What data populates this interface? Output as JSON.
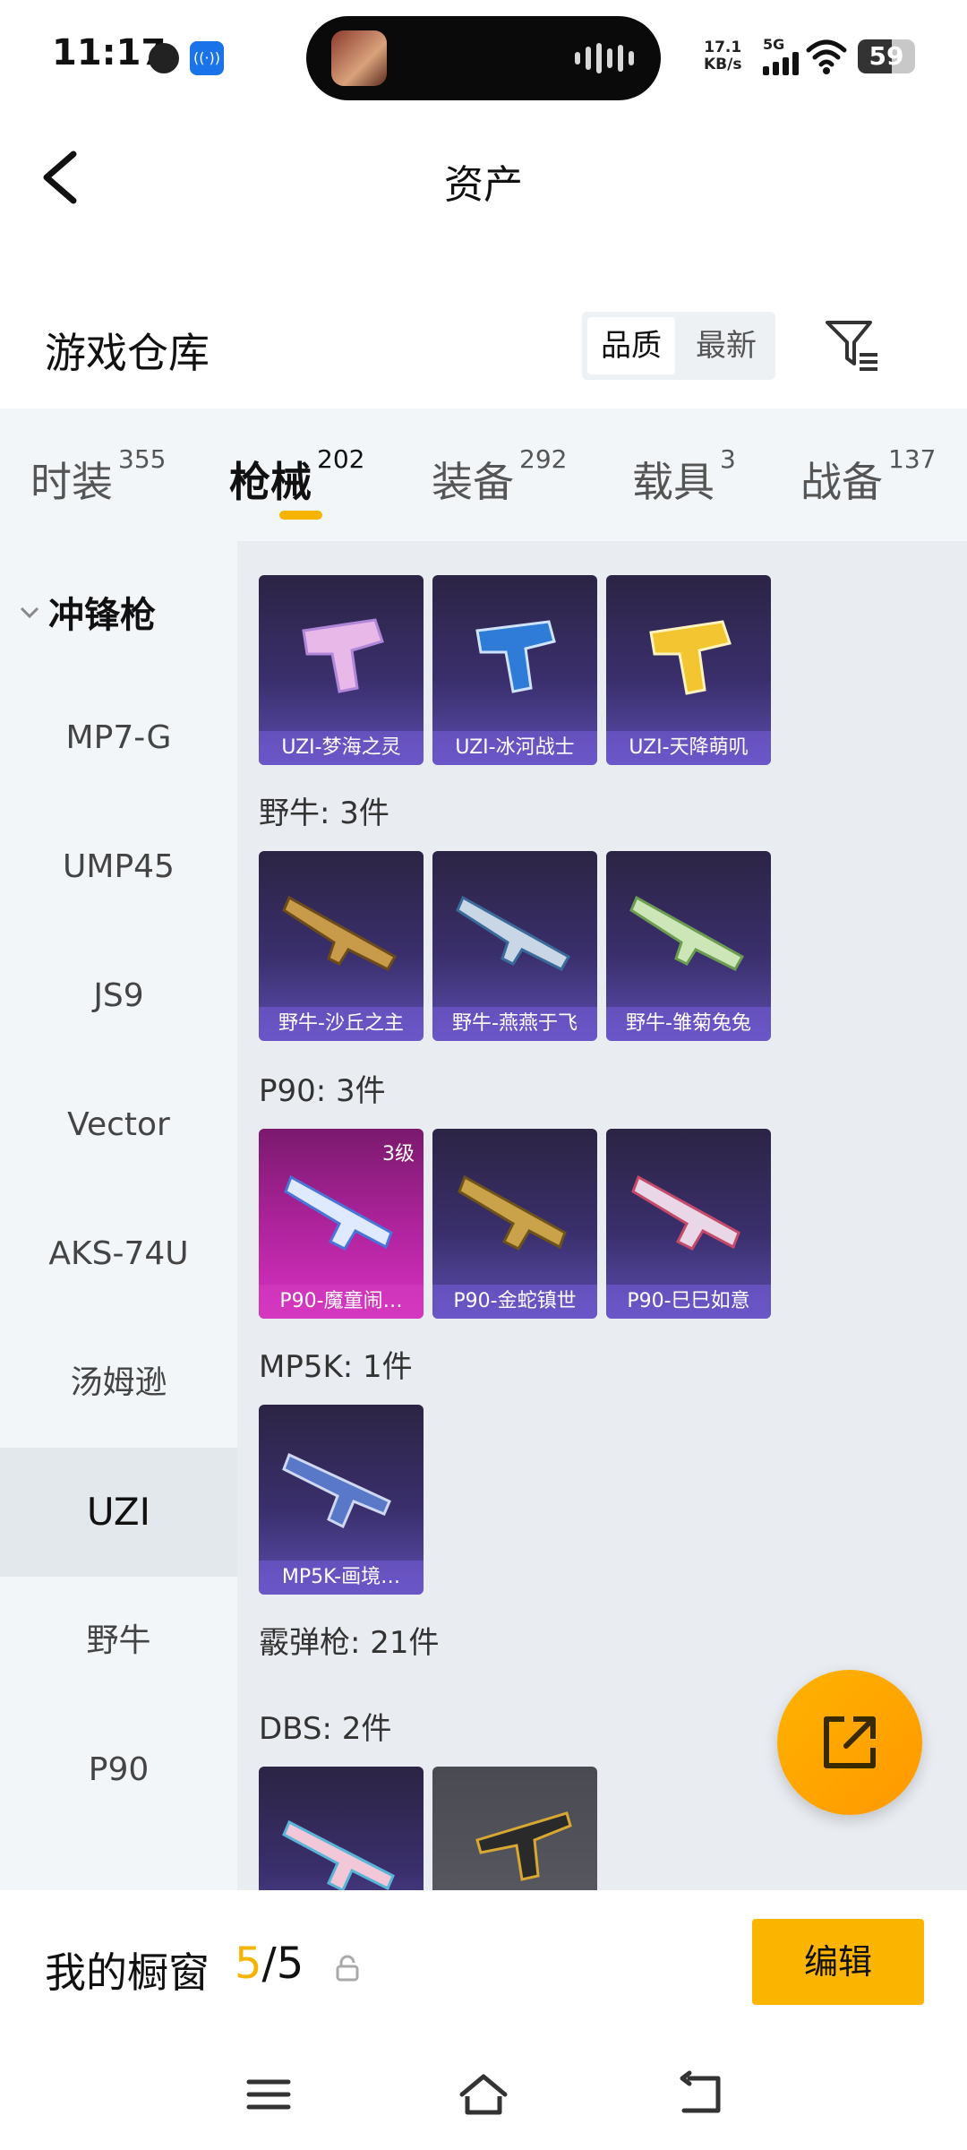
{
  "status_bar": {
    "time": "11:17",
    "net_speed_value": "17.1",
    "net_speed_unit": "KB/s",
    "network": "5G",
    "battery": "59",
    "battery_level": 0.59
  },
  "header": {
    "title": "资产"
  },
  "warehouse": {
    "title": "游戏仓库",
    "sort_options": [
      "品质",
      "最新"
    ]
  },
  "tabs": [
    {
      "label": "时装",
      "count": "355"
    },
    {
      "label": "枪械",
      "count": "202"
    },
    {
      "label": "装备",
      "count": "292"
    },
    {
      "label": "载具",
      "count": "3"
    },
    {
      "label": "战备",
      "count": "137"
    }
  ],
  "sidebar": {
    "group": "冲锋枪",
    "items": [
      "MP7-G",
      "UMP45",
      "JS9",
      "Vector",
      "AKS-74U",
      "汤姆逊",
      "UZI",
      "野牛",
      "P90"
    ],
    "active_index": 6
  },
  "sections": [
    {
      "label": "野牛: 3件"
    },
    {
      "label": "P90: 3件"
    },
    {
      "label": "MP5K: 1件"
    },
    {
      "label": "霰弹枪: 21件"
    },
    {
      "label": "DBS: 2件"
    }
  ],
  "items": {
    "uzi": [
      "UZI-梦海之灵",
      "UZI-冰河战士",
      "UZI-天降萌叽"
    ],
    "bison": [
      "野牛-沙丘之主",
      "野牛-燕燕于飞",
      "野牛-雏菊兔兔"
    ],
    "p90": [
      "P90-魔童闹…",
      "P90-金蛇镇世",
      "P90-巳巳如意"
    ],
    "p90_level": "3级",
    "mp5k": [
      "MP5K-画境…"
    ]
  },
  "showcase": {
    "title": "我的橱窗",
    "current": "5",
    "separator": "/",
    "total": "5",
    "edit_label": "编辑"
  },
  "icons": {
    "back": "back-arrow-icon",
    "filter": "filter-icon",
    "fab": "share-edit-icon",
    "lock": "lock-icon",
    "nav_menu": "menu-icon",
    "nav_home": "home-icon",
    "nav_back": "back-icon"
  },
  "colors": {
    "accent": "#f4b400",
    "edit_button": "#fbb400",
    "card_purple": "#5c4db0",
    "card_pink": "#d832c2"
  }
}
